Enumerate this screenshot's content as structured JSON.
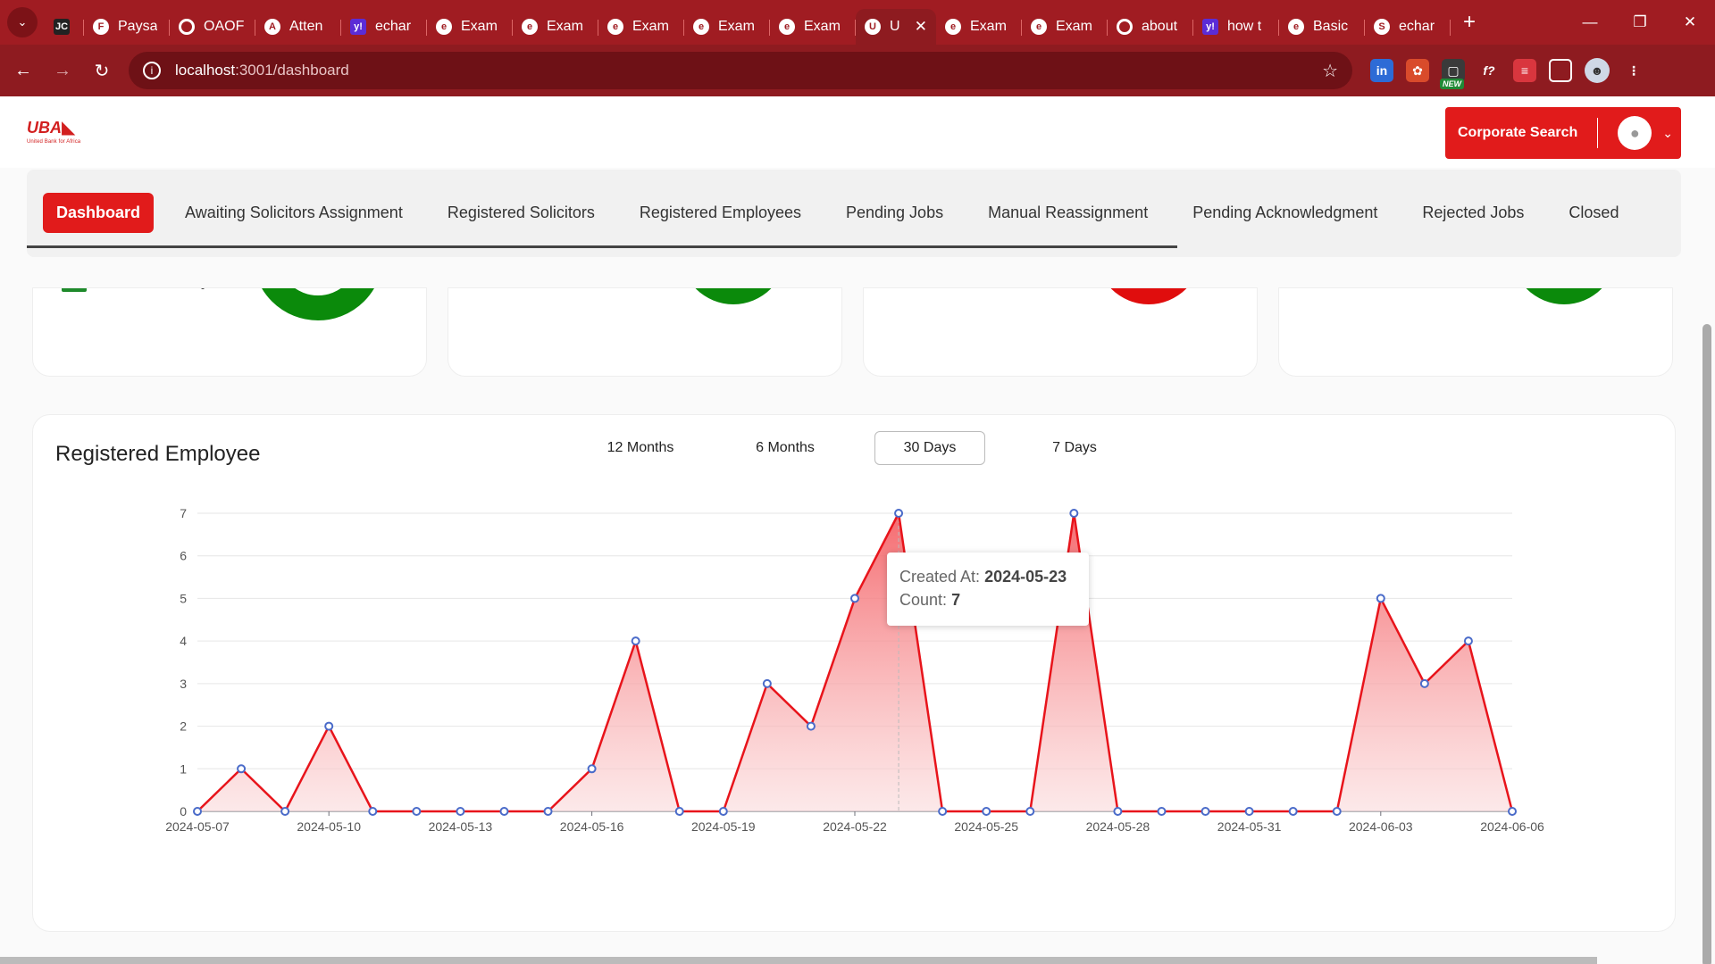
{
  "browser": {
    "tabs": [
      {
        "icon": "jetbrains-icon",
        "label": ""
      },
      {
        "icon": "figma-icon",
        "label": "Paysa"
      },
      {
        "icon": "globe-icon",
        "label": "OAOF"
      },
      {
        "icon": "angular-icon",
        "label": "Atten"
      },
      {
        "icon": "yahoo-icon",
        "label": "echar"
      },
      {
        "icon": "echarts-icon",
        "label": "Exam"
      },
      {
        "icon": "echarts-icon",
        "label": "Exam"
      },
      {
        "icon": "echarts-icon",
        "label": "Exam"
      },
      {
        "icon": "echarts-icon",
        "label": "Exam"
      },
      {
        "icon": "echarts-icon",
        "label": "Exam"
      },
      {
        "icon": "uba-icon",
        "label": "U",
        "active": true
      },
      {
        "icon": "echarts-icon",
        "label": "Exam"
      },
      {
        "icon": "echarts-icon",
        "label": "Exam"
      },
      {
        "icon": "globe-icon",
        "label": "about"
      },
      {
        "icon": "yahoo-icon",
        "label": "how t"
      },
      {
        "icon": "echarts-icon",
        "label": "Basic"
      },
      {
        "icon": "stackoverflow-icon",
        "label": "echar"
      }
    ],
    "url_host": "localhost",
    "url_path": ":3001/dashboard"
  },
  "header": {
    "logo_text": "UBA",
    "logo_tagline": "United Bank for Africa",
    "corporate_search_label": "Corporate Search"
  },
  "nav": {
    "items": [
      {
        "label": "Dashboard",
        "active": true
      },
      {
        "label": "Awaiting Solicitors Assignment"
      },
      {
        "label": "Registered Solicitors"
      },
      {
        "label": "Registered Employees"
      },
      {
        "label": "Pending Jobs"
      },
      {
        "label": "Manual Reassignment"
      },
      {
        "label": "Pending Acknowledgment"
      },
      {
        "label": "Rejected Jobs"
      },
      {
        "label": "Closed"
      }
    ]
  },
  "donut_colors": [
    "#0b8a0b",
    "#0b8a0b",
    "#e00d0d",
    "#0b8a0b"
  ],
  "chart": {
    "title": "Registered Employee",
    "ranges": [
      "12 Months",
      "6 Months",
      "30 Days",
      "7 Days"
    ],
    "selected_range": "30 Days",
    "tooltip": {
      "created_label": "Created At:",
      "created_value": "2024-05-23",
      "count_label": "Count:",
      "count_value": "7"
    }
  },
  "chart_data": {
    "type": "area",
    "title": "Registered Employee",
    "xlabel": "",
    "ylabel": "",
    "ylim": [
      0,
      7
    ],
    "yticks": [
      0,
      1,
      2,
      3,
      4,
      5,
      6,
      7
    ],
    "x": [
      "2024-05-07",
      "2024-05-08",
      "2024-05-09",
      "2024-05-10",
      "2024-05-11",
      "2024-05-12",
      "2024-05-13",
      "2024-05-14",
      "2024-05-15",
      "2024-05-16",
      "2024-05-17",
      "2024-05-18",
      "2024-05-19",
      "2024-05-20",
      "2024-05-21",
      "2024-05-22",
      "2024-05-23",
      "2024-05-24",
      "2024-05-25",
      "2024-05-26",
      "2024-05-27",
      "2024-05-28",
      "2024-05-29",
      "2024-05-30",
      "2024-05-31",
      "2024-06-01",
      "2024-06-02",
      "2024-06-03",
      "2024-06-04",
      "2024-06-05",
      "2024-06-06"
    ],
    "xtick_labels": [
      "2024-05-07",
      "2024-05-10",
      "2024-05-13",
      "2024-05-16",
      "2024-05-19",
      "2024-05-22",
      "2024-05-25",
      "2024-05-28",
      "2024-05-31",
      "2024-06-03",
      "2024-06-06"
    ],
    "values": [
      0,
      1,
      0,
      2,
      0,
      0,
      0,
      0,
      0,
      1,
      4,
      0,
      0,
      3,
      2,
      5,
      7,
      0,
      0,
      0,
      7,
      0,
      0,
      0,
      0,
      0,
      0,
      5,
      3,
      4,
      0
    ],
    "line_color": "#e8141b",
    "grid": true
  }
}
